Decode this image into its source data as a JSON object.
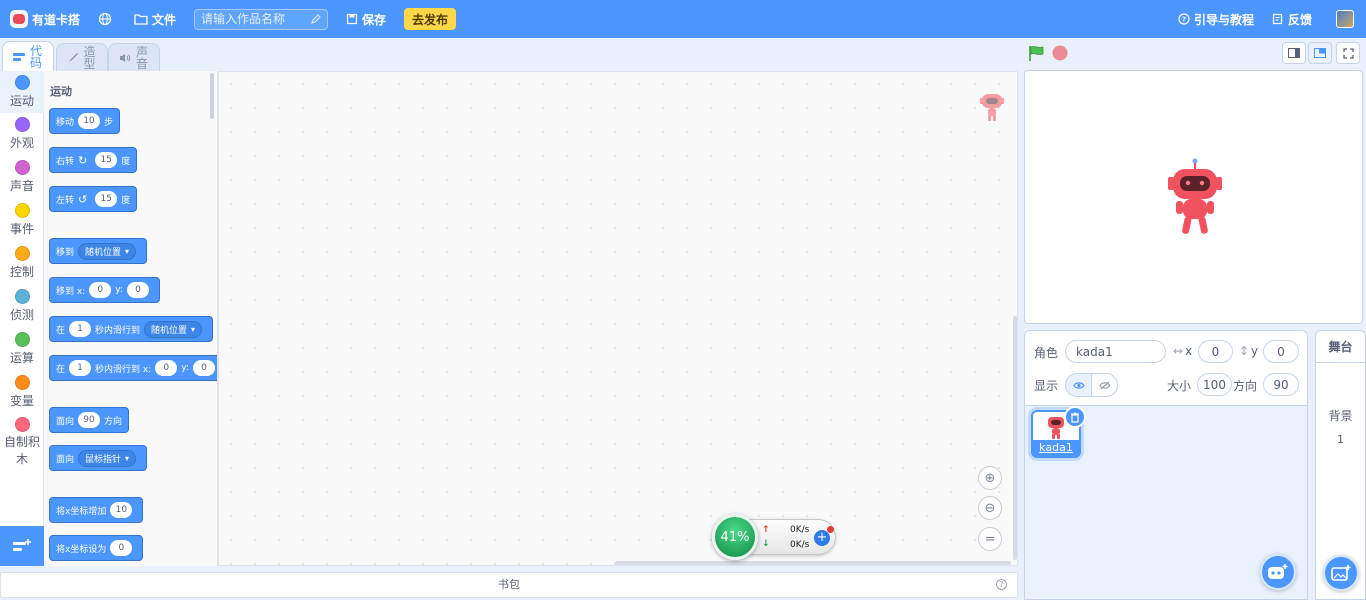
{
  "menubar": {
    "app_name": "有道卡搭",
    "file": "文件",
    "title_placeholder": "请输入作品名称",
    "save": "保存",
    "publish": "去发布",
    "guide": "引导与教程",
    "feedback": "反馈"
  },
  "tabs": [
    {
      "label": "代码",
      "active": true
    },
    {
      "label": "造型",
      "active": false
    },
    {
      "label": "声音",
      "active": false
    }
  ],
  "categories": [
    {
      "label": "运动",
      "color": "#4c97ff"
    },
    {
      "label": "外观",
      "color": "#9966ff"
    },
    {
      "label": "声音",
      "color": "#cf63cf"
    },
    {
      "label": "事件",
      "color": "#ffd500"
    },
    {
      "label": "控制",
      "color": "#ffab19"
    },
    {
      "label": "侦测",
      "color": "#5cb1d6"
    },
    {
      "label": "运算",
      "color": "#59c059"
    },
    {
      "label": "变量",
      "color": "#ff8c1a"
    },
    {
      "label": "自制积木",
      "color": "#ff6680"
    }
  ],
  "palette": {
    "section": "运动",
    "blocks": {
      "move": {
        "a": "移动",
        "v": "10",
        "b": "步"
      },
      "turn_right": {
        "a": "右转",
        "v": "15",
        "b": "度"
      },
      "turn_left": {
        "a": "左转",
        "v": "15",
        "b": "度"
      },
      "goto": {
        "a": "移到",
        "menu": "随机位置"
      },
      "goto_xy": {
        "a": "移到 x:",
        "x": "0",
        "b": "y:",
        "y": "0"
      },
      "glide": {
        "a": "在",
        "v": "1",
        "b": "秒内滑行到",
        "menu": "随机位置"
      },
      "glide_xy": {
        "a": "在",
        "v": "1",
        "b": "秒内滑行到 x:",
        "x": "0",
        "c": "y:",
        "y": "0"
      },
      "point_dir": {
        "a": "面向",
        "v": "90",
        "b": "方向"
      },
      "point_towards": {
        "a": "面向",
        "menu": "鼠标指针"
      },
      "change_x": {
        "a": "将x坐标增加",
        "v": "10"
      },
      "set_x": {
        "a": "将x坐标设为",
        "v": "0"
      }
    }
  },
  "speed": {
    "percent": "41%",
    "up": "0K/s",
    "down": "0K/s"
  },
  "backpack": "书包",
  "sprite_info": {
    "sprite_label": "角色",
    "name": "kada1",
    "x_label": "x",
    "x": "0",
    "y_label": "y",
    "y": "0",
    "show_label": "显示",
    "size_label": "大小",
    "size": "100",
    "direction_label": "方向",
    "direction": "90"
  },
  "sprites": [
    {
      "name": "kada1"
    }
  ],
  "stage_panel": {
    "header": "舞台",
    "backdrop_label": "背景",
    "backdrop_count": "1"
  },
  "colors": {
    "accent": "#4c97ff",
    "publish": "#ffd84a",
    "sprite": "#f0525f"
  }
}
